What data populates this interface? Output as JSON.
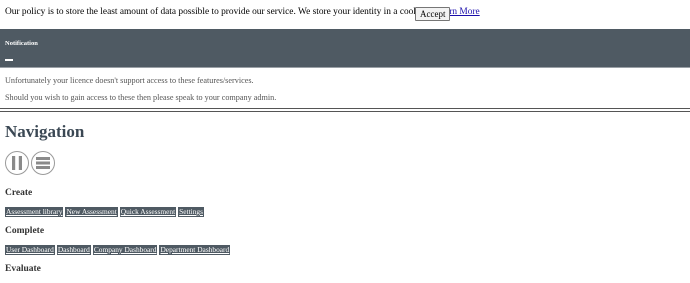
{
  "cookie_banner": {
    "text": "Our policy is to store the least amount of data possible to provide our service. We store your identity in a cookie",
    "learn_more": "Learn More",
    "accept": "Accept"
  },
  "notification": {
    "title": "Notification",
    "lines": [
      "Unfortunately your licence doesn't support access to these features/services.",
      "Should you wish to gain access to these then please speak to your company admin."
    ]
  },
  "navigation": {
    "heading": "Navigation",
    "icons": [
      "pause-icon",
      "menu-icon"
    ],
    "sections": [
      {
        "title": "Create",
        "links": [
          "Assessment library",
          "New Assessment",
          "Quick Assessment",
          "Settings"
        ]
      },
      {
        "title": "Complete",
        "links": [
          "User Dashboard",
          "Dashboard",
          "Company Dashboard",
          "Department Dashboard"
        ]
      },
      {
        "title": "Evaluate",
        "links": []
      }
    ]
  },
  "colors": {
    "nav_bar": "#4f5a63",
    "heading": "#3b4854",
    "link": "#1a0dab"
  }
}
